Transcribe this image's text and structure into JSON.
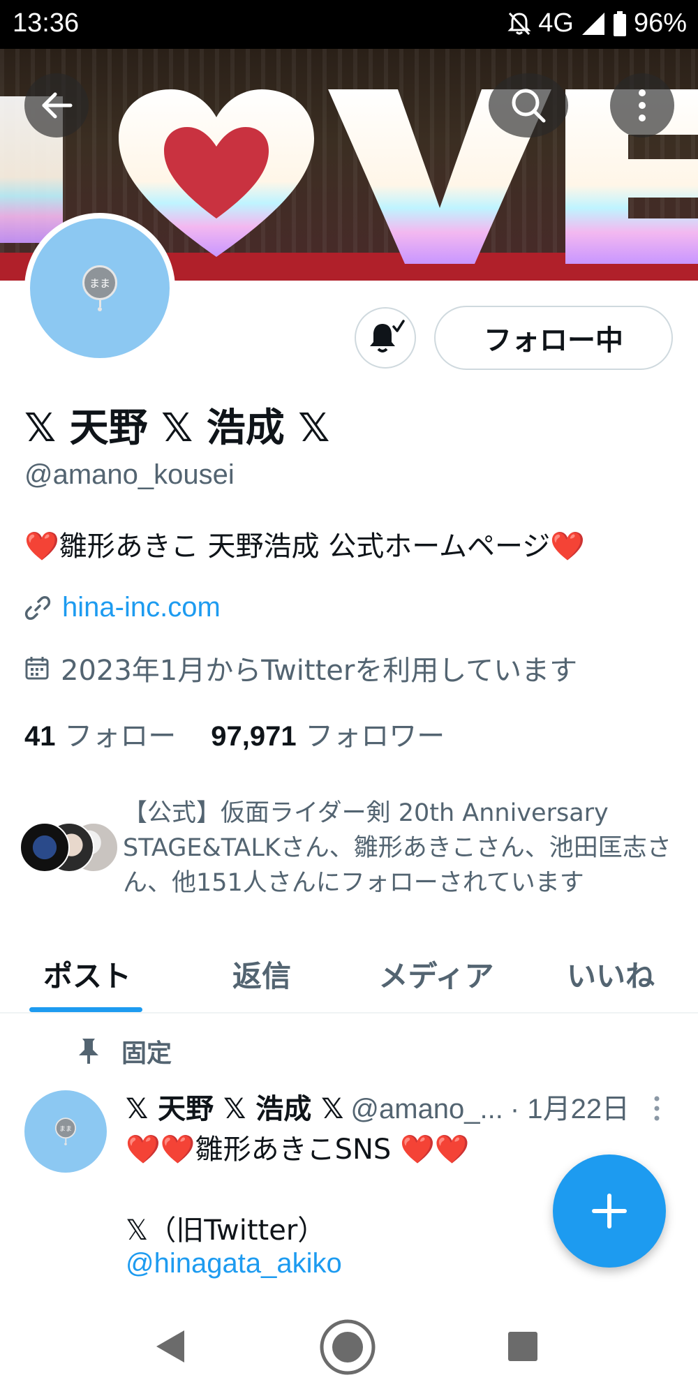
{
  "status_bar": {
    "time": "13:36",
    "network": "4G",
    "battery": "96%"
  },
  "header": {
    "back_icon": "arrow-left-icon",
    "search_icon": "search-icon",
    "more_icon": "more-vertical-icon"
  },
  "banner": {
    "text": "LOVE"
  },
  "avatar": {
    "badge_text": "まま"
  },
  "actions": {
    "notify_icon": "bell-check-icon",
    "follow_label": "フォロー中"
  },
  "profile": {
    "display_name": "𝕏 天野 𝕏 浩成 𝕏",
    "handle": "@amano_kousei",
    "bio": "❤️雛形あきこ 天野浩成 公式ホームページ❤️",
    "link": "hina-inc.com",
    "joined": "2023年1月からTwitterを利用しています",
    "following_count": "41",
    "following_label": "フォロー",
    "followers_count": "97,971",
    "followers_label": "フォロワー",
    "followed_by": "【公式】仮面ライダー剣 20th Anniversary STAGE&TALKさん、雛形あきこさん、池田匡志さん、他151人さんにフォローされています"
  },
  "tabs": [
    {
      "label": "ポスト",
      "active": true
    },
    {
      "label": "返信",
      "active": false
    },
    {
      "label": "メディア",
      "active": false
    },
    {
      "label": "いいね",
      "active": false
    }
  ],
  "pinned_post": {
    "pinned_label": "固定",
    "author_name": "𝕏 天野 𝕏 浩成 𝕏",
    "author_handle": "@amano_...",
    "date": "· 1月22日",
    "line1": "❤️❤️雛形あきこSNS ❤️❤️",
    "line2": "𝕏（旧Twitter）",
    "line3": "@hinagata_akiko"
  },
  "fab": {
    "icon": "plus-icon"
  },
  "nav": {
    "back_icon": "nav-back-icon",
    "home_icon": "nav-home-icon",
    "recents_icon": "nav-recents-icon"
  },
  "colors": {
    "accent": "#1d9bf0",
    "secondary_text": "#536471",
    "avatar_bg": "#8cc8f2"
  }
}
